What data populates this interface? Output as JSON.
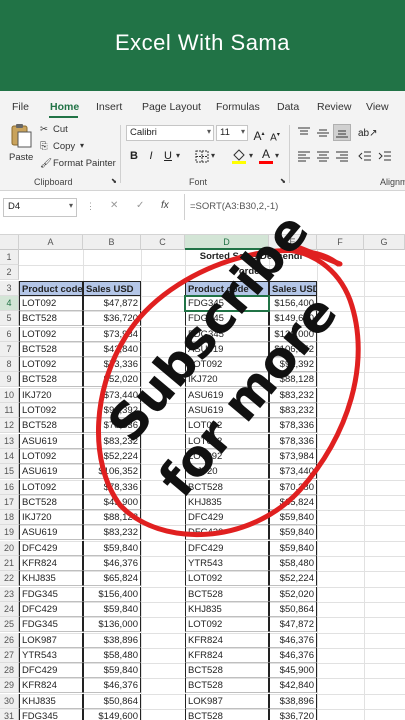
{
  "banner": {
    "title": "Excel With Sama"
  },
  "ribbon": {
    "tabs": [
      "File",
      "Home",
      "Insert",
      "Page Layout",
      "Formulas",
      "Data",
      "Review",
      "View"
    ],
    "active_tab": "Home",
    "clipboard": {
      "paste": "Paste",
      "cut": "Cut",
      "copy": "Copy",
      "format_painter": "Format Painter",
      "label": "Clipboard"
    },
    "font": {
      "family": "Calibri",
      "size": "11",
      "bold": "B",
      "italic": "I",
      "underline": "U",
      "label": "Font",
      "font_color": "#ff0000",
      "fill_color": "#ffff00"
    },
    "alignment": {
      "label": "Alignm"
    }
  },
  "formula_bar": {
    "name_box": "D4",
    "cancel": "✕",
    "enter": "✓",
    "fx": "fx",
    "formula": "=SORT(A3:B30,2,-1)"
  },
  "sheet": {
    "columns": [
      "A",
      "B",
      "C",
      "D",
      "E",
      "F",
      "G"
    ],
    "selected_column": "D",
    "rows": [
      "1",
      "2",
      "3",
      "4",
      "5",
      "6",
      "7",
      "8",
      "9",
      "10",
      "11",
      "12",
      "13",
      "14",
      "15",
      "16",
      "17",
      "18",
      "19",
      "20",
      "21",
      "22",
      "23",
      "24",
      "25",
      "26",
      "27",
      "28",
      "29",
      "30",
      "31"
    ],
    "selected_row": "4",
    "title_line1": "Sorted Sales Descendi",
    "title_line2": "order",
    "left_headers": [
      "Product code",
      "Sales USD"
    ],
    "right_headers": [
      "Product code",
      "Sales USD"
    ],
    "left_data": [
      [
        "LOT092",
        "$47,872"
      ],
      [
        "BCT528",
        "$36,720"
      ],
      [
        "LOT092",
        "$73,984"
      ],
      [
        "BCT528",
        "$42,840"
      ],
      [
        "LOT092",
        "$73,336"
      ],
      [
        "BCT528",
        "$52,020"
      ],
      [
        "IKJ720",
        "$73,440"
      ],
      [
        "LOT092",
        "$91,392"
      ],
      [
        "BCT528",
        "$78,336"
      ],
      [
        "ASU619",
        "$83,232"
      ],
      [
        "LOT092",
        "$52,224"
      ],
      [
        "ASU619",
        "$106,352"
      ],
      [
        "LOT092",
        "$78,336"
      ],
      [
        "BCT528",
        "$45,900"
      ],
      [
        "IKJ720",
        "$88,128"
      ],
      [
        "ASU619",
        "$83,232"
      ],
      [
        "DFC429",
        "$59,840"
      ],
      [
        "KFR824",
        "$46,376"
      ],
      [
        "KHJ835",
        "$65,824"
      ],
      [
        "FDG345",
        "$156,400"
      ],
      [
        "DFC429",
        "$59,840"
      ],
      [
        "FDG345",
        "$136,000"
      ],
      [
        "LOK987",
        "$38,896"
      ],
      [
        "YTR543",
        "$58,480"
      ],
      [
        "DFC429",
        "$59,840"
      ],
      [
        "KFR824",
        "$46,376"
      ],
      [
        "KHJ835",
        "$50,864"
      ],
      [
        "FDG345",
        "$149,600"
      ]
    ],
    "right_data": [
      [
        "FDG345",
        "$156,400"
      ],
      [
        "FDG345",
        "$149,600"
      ],
      [
        "FDG345",
        "$136,000"
      ],
      [
        "ASU619",
        "$106,352"
      ],
      [
        "LOT092",
        "$91,392"
      ],
      [
        "IKJ720",
        "$88,128"
      ],
      [
        "ASU619",
        "$83,232"
      ],
      [
        "ASU619",
        "$83,232"
      ],
      [
        "LOT092",
        "$78,336"
      ],
      [
        "LOT092",
        "$78,336"
      ],
      [
        "LOT092",
        "$73,984"
      ],
      [
        "IKJ720",
        "$73,440"
      ],
      [
        "BCT528",
        "$70,380"
      ],
      [
        "KHJ835",
        "$65,824"
      ],
      [
        "DFC429",
        "$59,840"
      ],
      [
        "DFC429",
        "$59,840"
      ],
      [
        "DFC429",
        "$59,840"
      ],
      [
        "YTR543",
        "$58,480"
      ],
      [
        "LOT092",
        "$52,224"
      ],
      [
        "BCT528",
        "$52,020"
      ],
      [
        "KHJ835",
        "$50,864"
      ],
      [
        "LOT092",
        "$47,872"
      ],
      [
        "KFR824",
        "$46,376"
      ],
      [
        "KFR824",
        "$46,376"
      ],
      [
        "BCT528",
        "$45,900"
      ],
      [
        "BCT528",
        "$42,840"
      ],
      [
        "LOK987",
        "$38,896"
      ],
      [
        "BCT528",
        "$36,720"
      ]
    ]
  },
  "overlay": {
    "line1": "Subscribe",
    "line2": "for more",
    "circle_color": "#e02020"
  }
}
